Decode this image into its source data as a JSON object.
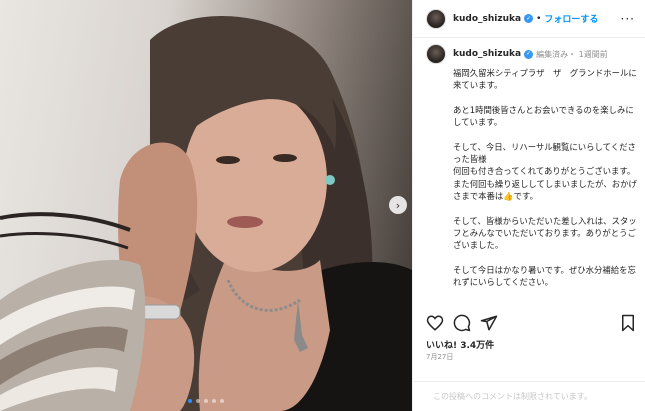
{
  "post": {
    "carousel": {
      "total": 5,
      "active_index": 0
    }
  },
  "header": {
    "username": "kudo_shizuka",
    "separator": "•",
    "follow_label": "フォローする",
    "more_label": "···"
  },
  "caption": {
    "username": "kudo_shizuka",
    "meta": "編集済み・ 1週間前",
    "paragraphs": [
      "福岡久留米シティプラザ　ザ　グランドホールに来ています。",
      "あと1時間後皆さんとお会いできるのを楽しみにしています。",
      "そして、今日、リハーサル観覧にいらしてくださった皆様\n何回も付き合ってくれてありがとうございます。また何回も繰り返ししてしまいましたが、おかげさまで本番は👍です。",
      "そして、皆様からいただいた差し入れは、スタッフとみんなでいただいております。ありがとうございました。",
      "そして今日はかなり暑いです。ぜひ水分補給を忘れずにいらしてください。"
    ]
  },
  "actions": {
    "like_icon": "heart-icon",
    "comment_icon": "comment-icon",
    "share_icon": "paper-plane-icon",
    "save_icon": "bookmark-icon"
  },
  "likes_text": "いいね! 3.4万件",
  "date_text": "7月27日",
  "comment_notice": "この投稿へのコメントは制限されています。",
  "colors": {
    "accent": "#0095f6",
    "verified": "#3897f0",
    "active_dot": "#2b8ef5"
  }
}
